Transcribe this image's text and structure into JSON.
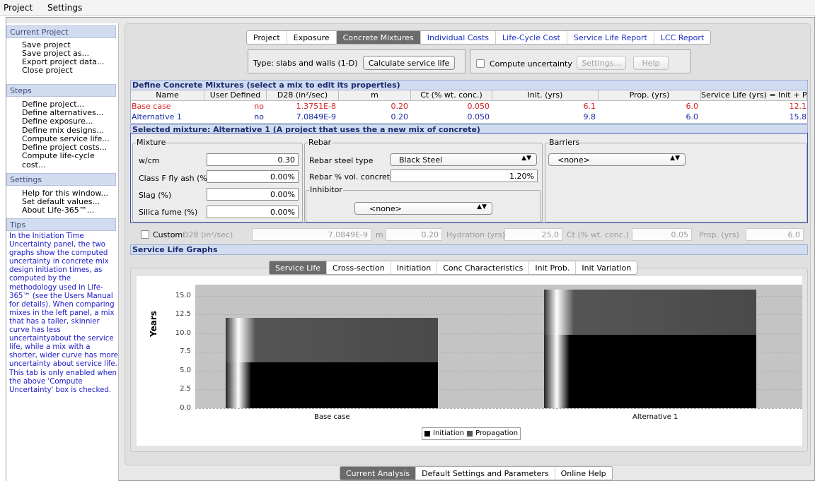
{
  "menu": [
    "Project",
    "Settings"
  ],
  "sidebar": {
    "current_project": {
      "header": "Current Project",
      "items": [
        "Save project",
        "Save project as...",
        "Export project data...",
        "Close project"
      ]
    },
    "steps": {
      "header": "Steps",
      "items": [
        "Define project...",
        "Define alternatives...",
        "Define exposure...",
        "Define mix designs...",
        "Compute service life...",
        "Define project costs...",
        "Compute life-cycle cost..."
      ]
    },
    "settings": {
      "header": "Settings",
      "items": [
        "Help for this window...",
        "Set default values...",
        "About Life-365™..."
      ]
    },
    "tips": {
      "header": "Tips",
      "text": "In the Initiation Time Uncertainty panel, the two graphs show the computed uncertainty in concrete mix design initiation times, as computed by the methodology used in Life-365™ (see the Users Manual for details). When comparing mixes in the left panel, a mix that has a taller, skinnier curve has less uncertaintyabout the service life, while a mix with a shorter, wider curve has more uncertainty about service life. This tab is only enabled when the above 'Compute Uncertainty' box is checked."
    }
  },
  "top_tabs": [
    "Project",
    "Exposure",
    "Concrete Mixtures",
    "Individual Costs",
    "Life-Cycle Cost",
    "Service Life Report",
    "LCC Report"
  ],
  "type_label": "Type: slabs and walls (1-D)",
  "calc_button": "Calculate service life",
  "compute_uncertainty": "Compute uncertainty",
  "settings_button": "Settings...",
  "help_button": "Help",
  "define_header": "Define Concrete Mixtures (select a mix to edit its properties)",
  "table": {
    "headers": [
      "Name",
      "User Defined",
      "D28 (in²/sec)",
      "m",
      "Ct (% wt. conc.)",
      "Init. (yrs)",
      "Prop. (yrs)",
      "Service Life (yrs) = Init + P..."
    ],
    "rows": [
      {
        "name": "Base case",
        "user_defined": "no",
        "d28": "1.3751E-8",
        "m": "0.20",
        "ct": "0.050",
        "init": "6.1",
        "prop": "6.0",
        "service_life": "12.1"
      },
      {
        "name": "Alternative 1",
        "user_defined": "no",
        "d28": "7.0849E-9",
        "m": "0.20",
        "ct": "0.050",
        "init": "9.8",
        "prop": "6.0",
        "service_life": "15.8"
      }
    ]
  },
  "selected_header": "Selected mixture: Alternative 1 (A project that uses the a new mix of concrete)",
  "mixture": {
    "label": "Mixture",
    "wcm_label": "w/cm",
    "wcm": "0.30",
    "flyash_label": "Class F fly ash (%)",
    "flyash": "0.00%",
    "slag_label": "Slag (%)",
    "slag": "0.00%",
    "silica_label": "Silica fume (%)",
    "silica": "0.00%"
  },
  "rebar": {
    "label": "Rebar",
    "type_label": "Rebar steel type",
    "type": "Black Steel",
    "vol_label": "Rebar % vol. concrete",
    "vol": "1.20%"
  },
  "inhibitor": {
    "label": "Inhibitor",
    "value": "<none>"
  },
  "barriers": {
    "label": "Barriers",
    "value": "<none>"
  },
  "custom": {
    "label": "Custom:",
    "d28_label": "D28 (in²/sec)",
    "d28": "7.0849E-9",
    "m_label": "m",
    "m": "0.20",
    "hydration_label": "Hydration (yrs)",
    "hydration": "25.0",
    "ct_label": "Ct (% wt. conc.)",
    "ct": "0.05",
    "prop_label": "Prop. (yrs)",
    "prop": "6.0"
  },
  "graphs_header": "Service Life Graphs",
  "graph_tabs": [
    "Service Life",
    "Cross-section",
    "Initiation",
    "Conc Characteristics",
    "Init Prob.",
    "Init Variation"
  ],
  "bottom_tabs": [
    "Current Analysis",
    "Default Settings and Parameters",
    "Online Help"
  ],
  "colors": {
    "initiation": "#000000",
    "propagation": "#4a4a4a",
    "accent_blue": "#1a2fc4",
    "header_blue": "#d2dcf0"
  },
  "chart_data": {
    "type": "bar",
    "stacked": true,
    "categories": [
      "Base case",
      "Alternative 1"
    ],
    "series": [
      {
        "name": "Initiation",
        "values": [
          6.1,
          9.8
        ]
      },
      {
        "name": "Propagation",
        "values": [
          6.0,
          6.0
        ]
      }
    ],
    "ylabel": "Years",
    "ylim": [
      0,
      16.5
    ],
    "yticks": [
      "0.0",
      "2.5",
      "5.0",
      "7.5",
      "10.0",
      "12.5",
      "15.0"
    ],
    "legend": "bottom-center",
    "grid": true
  }
}
